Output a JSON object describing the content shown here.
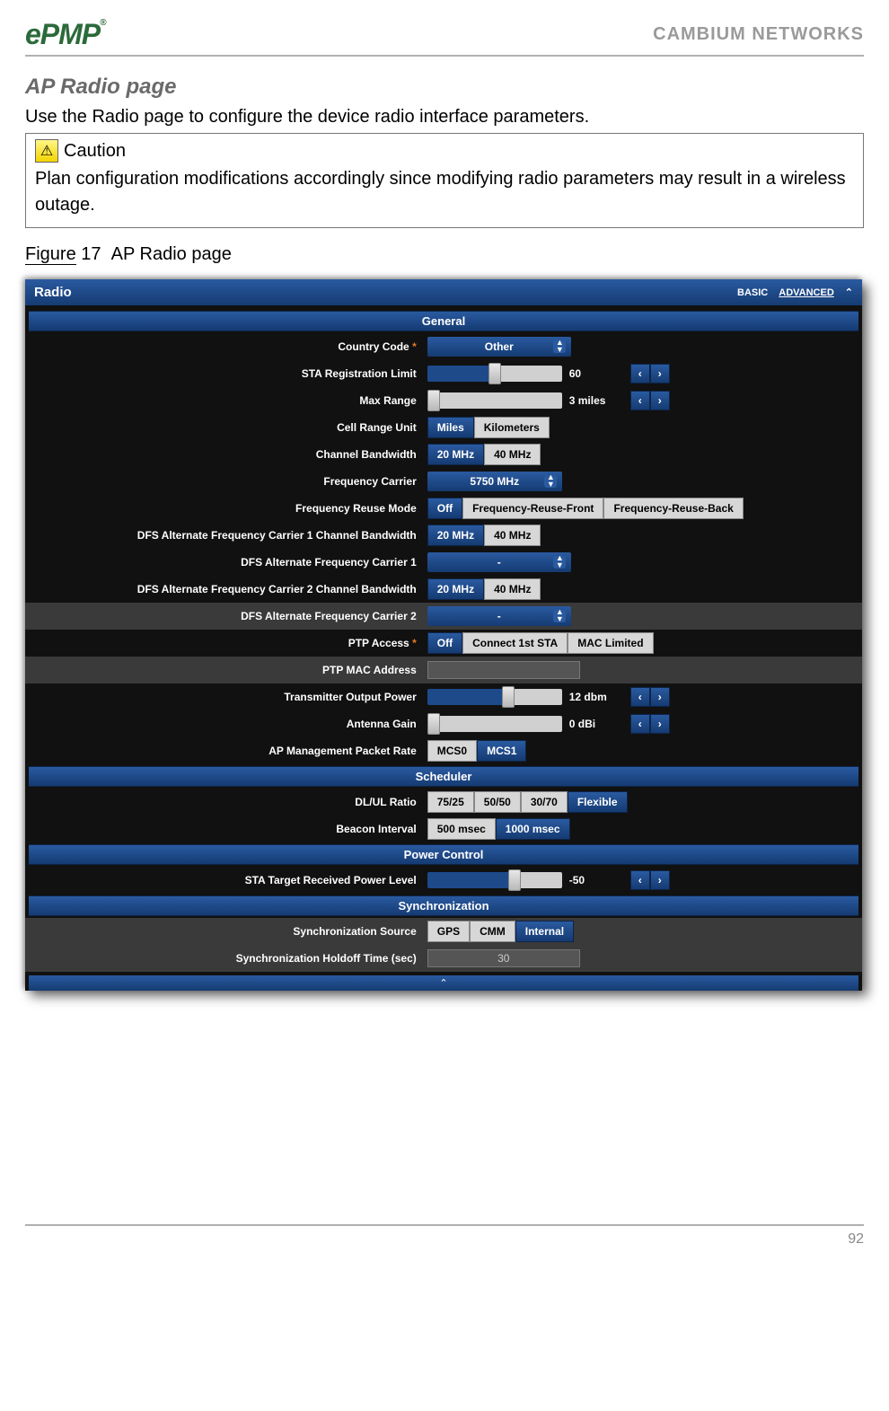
{
  "header": {
    "logo_text": "ePMP",
    "company": "CAMBIUM NETWORKS"
  },
  "doc": {
    "section_title": "AP Radio page",
    "intro": "Use the Radio page to configure the device radio interface parameters.",
    "caution_label": "Caution",
    "caution_text": "Plan configuration modifications accordingly since modifying radio parameters may result in a wireless outage.",
    "figure_word": "Figure",
    "figure_num": "17",
    "figure_caption": "AP Radio page",
    "page_number": "92"
  },
  "ui": {
    "panel_title": "Radio",
    "mode_basic": "BASIC",
    "mode_advanced": "ADVANCED",
    "sections": {
      "general": "General",
      "scheduler": "Scheduler",
      "power": "Power Control",
      "sync": "Synchronization"
    },
    "general": {
      "country_code": {
        "label": "Country Code",
        "value": "Other"
      },
      "sta_reg": {
        "label": "STA Registration Limit",
        "value": "60"
      },
      "max_range": {
        "label": "Max Range",
        "value": "3 miles"
      },
      "cell_range_unit": {
        "label": "Cell Range Unit",
        "opts": [
          "Miles",
          "Kilometers"
        ],
        "selected": 0
      },
      "channel_bw": {
        "label": "Channel Bandwidth",
        "opts": [
          "20 MHz",
          "40 MHz"
        ],
        "selected": 0
      },
      "freq_carrier": {
        "label": "Frequency Carrier",
        "value": "5750 MHz"
      },
      "freq_reuse": {
        "label": "Frequency Reuse Mode",
        "opts": [
          "Off",
          "Frequency-Reuse-Front",
          "Frequency-Reuse-Back"
        ],
        "selected": 0
      },
      "dfs1_bw": {
        "label": "DFS Alternate Frequency Carrier 1 Channel Bandwidth",
        "opts": [
          "20 MHz",
          "40 MHz"
        ],
        "selected": 0
      },
      "dfs1": {
        "label": "DFS Alternate Frequency Carrier 1",
        "value": "-"
      },
      "dfs2_bw": {
        "label": "DFS Alternate Frequency Carrier 2 Channel Bandwidth",
        "opts": [
          "20 MHz",
          "40 MHz"
        ],
        "selected": 0
      },
      "dfs2": {
        "label": "DFS Alternate Frequency Carrier 2",
        "value": "-"
      },
      "ptp_access": {
        "label": "PTP Access",
        "opts": [
          "Off",
          "Connect 1st STA",
          "MAC Limited"
        ],
        "selected": 0
      },
      "ptp_mac": {
        "label": "PTP MAC Address",
        "value": ""
      },
      "tx_power": {
        "label": "Transmitter Output Power",
        "value": "12 dbm"
      },
      "ant_gain": {
        "label": "Antenna Gain",
        "value": "0 dBi"
      },
      "ap_mgmt_rate": {
        "label": "AP Management Packet Rate",
        "opts": [
          "MCS0",
          "MCS1"
        ],
        "selected": 1
      }
    },
    "scheduler": {
      "dlul": {
        "label": "DL/UL Ratio",
        "opts": [
          "75/25",
          "50/50",
          "30/70",
          "Flexible"
        ],
        "selected": 3
      },
      "beacon": {
        "label": "Beacon Interval",
        "opts": [
          "500 msec",
          "1000 msec"
        ],
        "selected": 1
      }
    },
    "power": {
      "sta_target": {
        "label": "STA Target Received Power Level",
        "value": "-50"
      }
    },
    "sync": {
      "source": {
        "label": "Synchronization Source",
        "opts": [
          "GPS",
          "CMM",
          "Internal"
        ],
        "selected": 2
      },
      "holdoff": {
        "label": "Synchronization Holdoff Time (sec)",
        "value": "30"
      }
    }
  }
}
